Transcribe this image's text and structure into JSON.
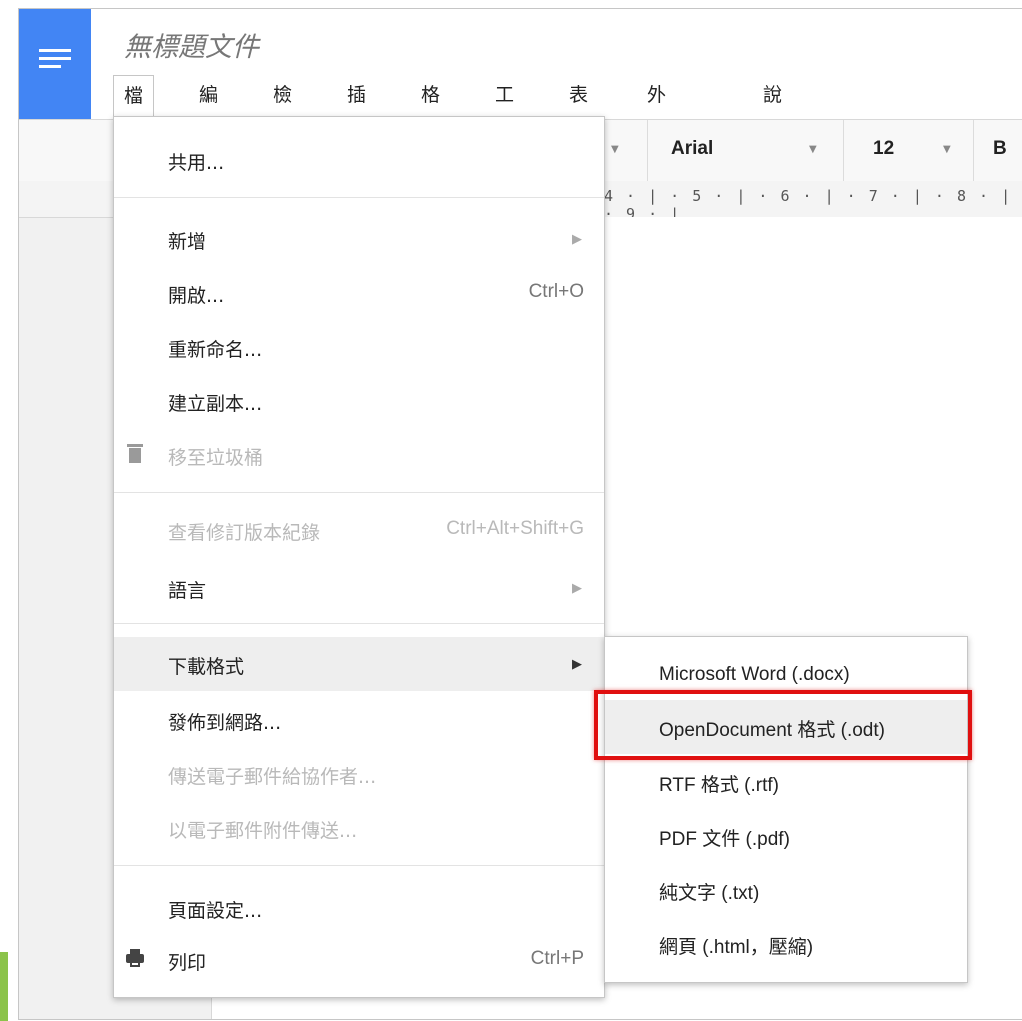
{
  "document": {
    "title": "無標題文件"
  },
  "menubar": {
    "items": [
      "檔案",
      "編輯",
      "檢視",
      "插入",
      "格式",
      "工具",
      "表格",
      "外掛程式",
      "說明"
    ]
  },
  "toolbar": {
    "font": "Arial",
    "size": "12",
    "bold": "B"
  },
  "ruler": {
    "ticks": "4 · | · 5 · | · 6 · | · 7 · | · 8 · | · 9 · |"
  },
  "file_menu": {
    "share": "共用...",
    "new": "新增",
    "open": "開啟...",
    "open_shortcut": "Ctrl+O",
    "rename": "重新命名...",
    "copy": "建立副本...",
    "trash": "移至垃圾桶",
    "revisions": "查看修訂版本紀錄",
    "revisions_shortcut": "Ctrl+Alt+Shift+G",
    "language": "語言",
    "download": "下載格式",
    "publish": "發佈到網路...",
    "email_collab": "傳送電子郵件給協作者...",
    "email_attach": "以電子郵件附件傳送...",
    "page_setup": "頁面設定...",
    "print": "列印",
    "print_shortcut": "Ctrl+P"
  },
  "download_submenu": {
    "docx": "Microsoft Word (.docx)",
    "odt": "OpenDocument 格式 (.odt)",
    "rtf": "RTF 格式 (.rtf)",
    "pdf": "PDF 文件 (.pdf)",
    "txt": "純文字 (.txt)",
    "html": "網頁 (.html，壓縮)"
  },
  "icons": {
    "app": "docs-menu-icon",
    "trash": "trash-icon",
    "print": "printer-icon",
    "submenu": "triangle-right-icon"
  },
  "colors": {
    "brand": "#4285f4",
    "highlight_box": "#e01010",
    "menu_hover": "#eeeeee"
  }
}
